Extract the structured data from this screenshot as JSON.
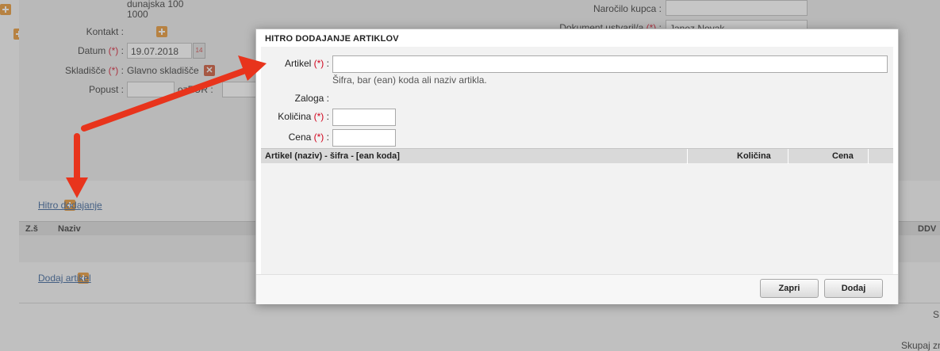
{
  "background": {
    "address_line1": "dunajska 100",
    "address_line2": "1000",
    "kontakt_label": "Kontakt :",
    "datum_label": "Datum",
    "datum_value": "19.07.2018",
    "skladisce_label": "Skladišče",
    "skladisce_value": "Glavno skladišče",
    "popust_label": "Popust :",
    "popust_mid_label": "ozEUR :",
    "narocilo_label": "Naročilo kupca :",
    "dokument_label": "Dokument ustvaril/a",
    "dokument_value": "Janez Novak",
    "required_mark": "(*)",
    "colon": ":",
    "hitro_link": "Hitro dodajanje",
    "table_headers": [
      "Z.š",
      "Naziv",
      "DDV"
    ],
    "dodaj_artikel_link": "Dodaj artikel",
    "bottom_right_1": "S",
    "bottom_right_2": "Skupaj zn",
    "calendar_icon_label": "14",
    "remove_icon": "✕"
  },
  "modal": {
    "title": "HITRO DODAJANJE ARTIKLOV",
    "artikel_label": "Artikel",
    "artikel_value": "",
    "artikel_hint": "Šifra, bar (ean) koda ali naziv artikla.",
    "zaloga_label": "Zaloga :",
    "kolicina_label": "Količina",
    "cena_label": "Cena",
    "required_mark": "(*)",
    "colon": ":",
    "table_headers": {
      "artikel": "Artikel (naziv) - šifra - [ean koda]",
      "kolicina": "Količina",
      "cena": "Cena"
    },
    "zapri_button": "Zapri",
    "dodaj_button": "Dodaj"
  },
  "annotations": {
    "arrow_color": "#e8341c"
  }
}
